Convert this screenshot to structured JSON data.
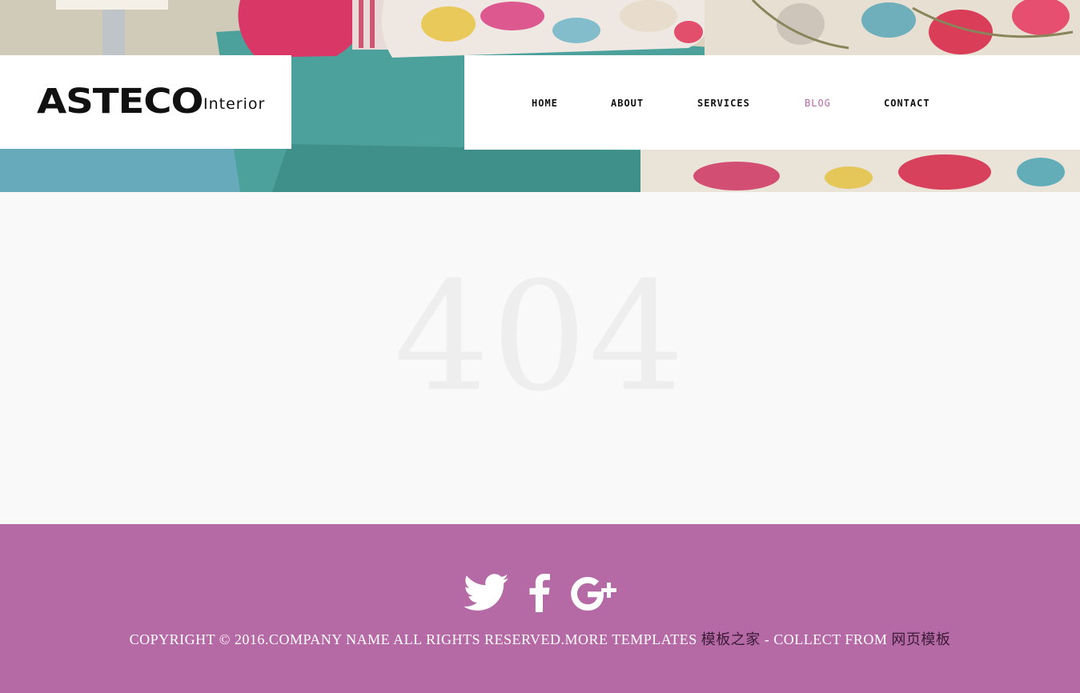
{
  "logo": {
    "main": "ASTECO",
    "sub": "Interior"
  },
  "nav": {
    "items": [
      {
        "label": "HOME",
        "active": false
      },
      {
        "label": "ABOUT",
        "active": false
      },
      {
        "label": "SERVICES",
        "active": false
      },
      {
        "label": "BLOG",
        "active": true
      },
      {
        "label": "CONTACT",
        "active": false
      }
    ]
  },
  "main": {
    "error_code": "404"
  },
  "footer": {
    "social": [
      {
        "name": "twitter-icon"
      },
      {
        "name": "facebook-icon"
      },
      {
        "name": "google-plus-icon"
      }
    ],
    "copyright_prefix": "COPYRIGHT © 2016.COMPANY NAME ALL RIGHTS RESERVED.MORE TEMPLATES ",
    "link1": "模板之家",
    "separator": " - COLLECT FROM ",
    "link2": "网页模板"
  },
  "colors": {
    "accent": "#b56aa6",
    "nav_active": "#b567a7",
    "error_text": "#eeeeee",
    "link_dark": "#3b1a36"
  }
}
